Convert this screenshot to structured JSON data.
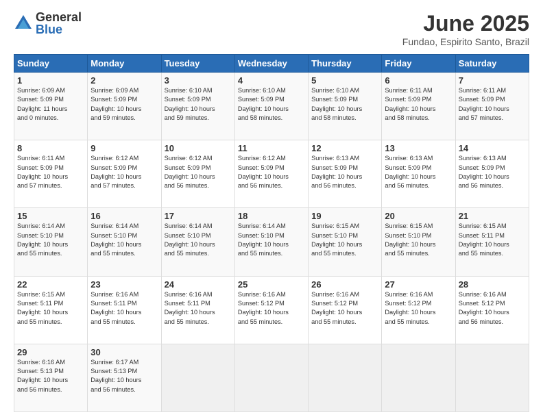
{
  "logo": {
    "general": "General",
    "blue": "Blue"
  },
  "title": "June 2025",
  "subtitle": "Fundao, Espirito Santo, Brazil",
  "header_days": [
    "Sunday",
    "Monday",
    "Tuesday",
    "Wednesday",
    "Thursday",
    "Friday",
    "Saturday"
  ],
  "weeks": [
    [
      {
        "day": "1",
        "info": "Sunrise: 6:09 AM\nSunset: 5:09 PM\nDaylight: 11 hours\nand 0 minutes."
      },
      {
        "day": "2",
        "info": "Sunrise: 6:09 AM\nSunset: 5:09 PM\nDaylight: 10 hours\nand 59 minutes."
      },
      {
        "day": "3",
        "info": "Sunrise: 6:10 AM\nSunset: 5:09 PM\nDaylight: 10 hours\nand 59 minutes."
      },
      {
        "day": "4",
        "info": "Sunrise: 6:10 AM\nSunset: 5:09 PM\nDaylight: 10 hours\nand 58 minutes."
      },
      {
        "day": "5",
        "info": "Sunrise: 6:10 AM\nSunset: 5:09 PM\nDaylight: 10 hours\nand 58 minutes."
      },
      {
        "day": "6",
        "info": "Sunrise: 6:11 AM\nSunset: 5:09 PM\nDaylight: 10 hours\nand 58 minutes."
      },
      {
        "day": "7",
        "info": "Sunrise: 6:11 AM\nSunset: 5:09 PM\nDaylight: 10 hours\nand 57 minutes."
      }
    ],
    [
      {
        "day": "8",
        "info": "Sunrise: 6:11 AM\nSunset: 5:09 PM\nDaylight: 10 hours\nand 57 minutes."
      },
      {
        "day": "9",
        "info": "Sunrise: 6:12 AM\nSunset: 5:09 PM\nDaylight: 10 hours\nand 57 minutes."
      },
      {
        "day": "10",
        "info": "Sunrise: 6:12 AM\nSunset: 5:09 PM\nDaylight: 10 hours\nand 56 minutes."
      },
      {
        "day": "11",
        "info": "Sunrise: 6:12 AM\nSunset: 5:09 PM\nDaylight: 10 hours\nand 56 minutes."
      },
      {
        "day": "12",
        "info": "Sunrise: 6:13 AM\nSunset: 5:09 PM\nDaylight: 10 hours\nand 56 minutes."
      },
      {
        "day": "13",
        "info": "Sunrise: 6:13 AM\nSunset: 5:09 PM\nDaylight: 10 hours\nand 56 minutes."
      },
      {
        "day": "14",
        "info": "Sunrise: 6:13 AM\nSunset: 5:09 PM\nDaylight: 10 hours\nand 56 minutes."
      }
    ],
    [
      {
        "day": "15",
        "info": "Sunrise: 6:14 AM\nSunset: 5:10 PM\nDaylight: 10 hours\nand 55 minutes."
      },
      {
        "day": "16",
        "info": "Sunrise: 6:14 AM\nSunset: 5:10 PM\nDaylight: 10 hours\nand 55 minutes."
      },
      {
        "day": "17",
        "info": "Sunrise: 6:14 AM\nSunset: 5:10 PM\nDaylight: 10 hours\nand 55 minutes."
      },
      {
        "day": "18",
        "info": "Sunrise: 6:14 AM\nSunset: 5:10 PM\nDaylight: 10 hours\nand 55 minutes."
      },
      {
        "day": "19",
        "info": "Sunrise: 6:15 AM\nSunset: 5:10 PM\nDaylight: 10 hours\nand 55 minutes."
      },
      {
        "day": "20",
        "info": "Sunrise: 6:15 AM\nSunset: 5:10 PM\nDaylight: 10 hours\nand 55 minutes."
      },
      {
        "day": "21",
        "info": "Sunrise: 6:15 AM\nSunset: 5:11 PM\nDaylight: 10 hours\nand 55 minutes."
      }
    ],
    [
      {
        "day": "22",
        "info": "Sunrise: 6:15 AM\nSunset: 5:11 PM\nDaylight: 10 hours\nand 55 minutes."
      },
      {
        "day": "23",
        "info": "Sunrise: 6:16 AM\nSunset: 5:11 PM\nDaylight: 10 hours\nand 55 minutes."
      },
      {
        "day": "24",
        "info": "Sunrise: 6:16 AM\nSunset: 5:11 PM\nDaylight: 10 hours\nand 55 minutes."
      },
      {
        "day": "25",
        "info": "Sunrise: 6:16 AM\nSunset: 5:12 PM\nDaylight: 10 hours\nand 55 minutes."
      },
      {
        "day": "26",
        "info": "Sunrise: 6:16 AM\nSunset: 5:12 PM\nDaylight: 10 hours\nand 55 minutes."
      },
      {
        "day": "27",
        "info": "Sunrise: 6:16 AM\nSunset: 5:12 PM\nDaylight: 10 hours\nand 55 minutes."
      },
      {
        "day": "28",
        "info": "Sunrise: 6:16 AM\nSunset: 5:12 PM\nDaylight: 10 hours\nand 56 minutes."
      }
    ],
    [
      {
        "day": "29",
        "info": "Sunrise: 6:16 AM\nSunset: 5:13 PM\nDaylight: 10 hours\nand 56 minutes."
      },
      {
        "day": "30",
        "info": "Sunrise: 6:17 AM\nSunset: 5:13 PM\nDaylight: 10 hours\nand 56 minutes."
      },
      {
        "day": "",
        "info": ""
      },
      {
        "day": "",
        "info": ""
      },
      {
        "day": "",
        "info": ""
      },
      {
        "day": "",
        "info": ""
      },
      {
        "day": "",
        "info": ""
      }
    ]
  ]
}
